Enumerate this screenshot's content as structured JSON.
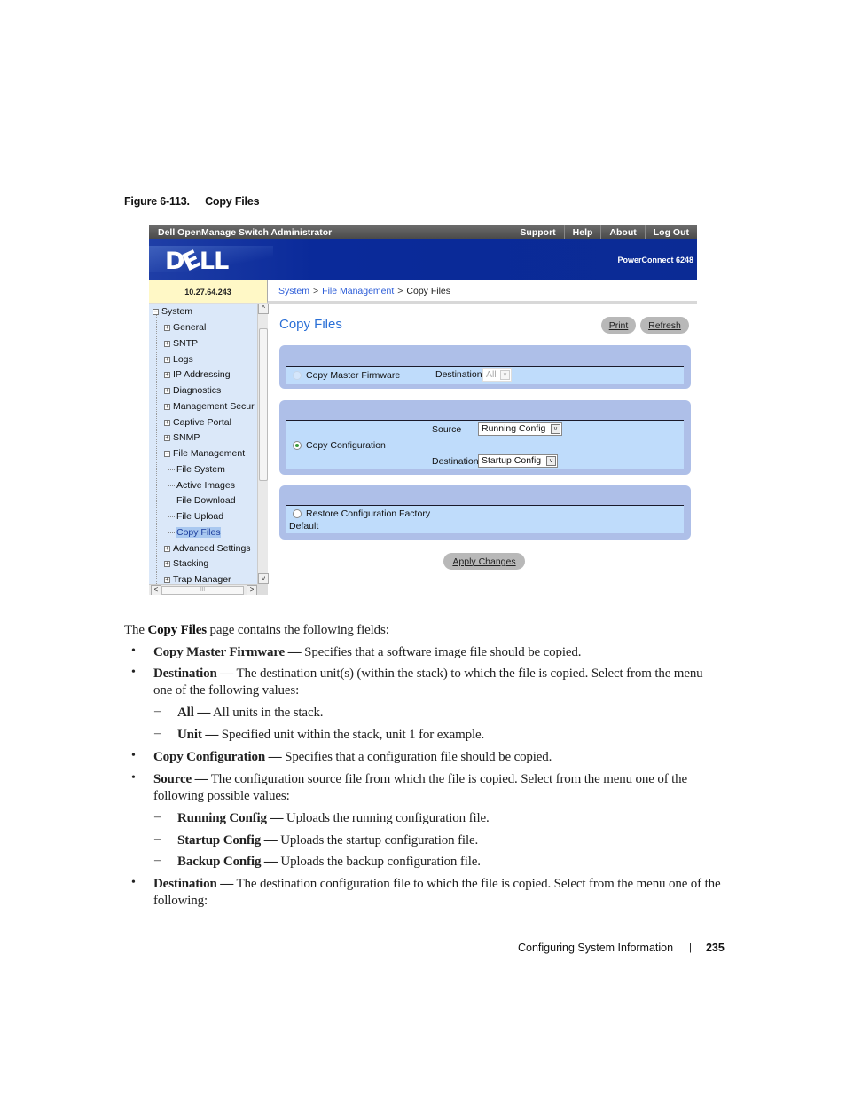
{
  "figure": {
    "number": "Figure 6-113.",
    "title": "Copy Files"
  },
  "app": {
    "title": "Dell OpenManage Switch Administrator",
    "top_links": [
      "Support",
      "Help",
      "About",
      "Log Out"
    ],
    "logo": {
      "d": "D",
      "e": "E",
      "ll": "LL"
    },
    "product": "PowerConnect 6248",
    "ip_address": "10.27.64.243",
    "breadcrumb": {
      "items": [
        "System",
        "File Management",
        "Copy Files"
      ],
      "separator": ">"
    }
  },
  "sidebar": {
    "root": "System",
    "items": [
      {
        "label": "General"
      },
      {
        "label": "SNTP"
      },
      {
        "label": "Logs"
      },
      {
        "label": "IP Addressing"
      },
      {
        "label": "Diagnostics"
      },
      {
        "label": "Management Secur"
      },
      {
        "label": "Captive Portal"
      },
      {
        "label": "SNMP"
      },
      {
        "label": "File Management"
      },
      {
        "label": "File System"
      },
      {
        "label": "Active Images"
      },
      {
        "label": "File Download"
      },
      {
        "label": "File Upload"
      },
      {
        "label": "Copy Files"
      },
      {
        "label": "Advanced Settings"
      },
      {
        "label": "Stacking"
      },
      {
        "label": "Trap Manager"
      }
    ],
    "selected": "Copy Files",
    "scroll_up": "^",
    "scroll_down": "v",
    "scroll_left": "<",
    "scroll_right": ">",
    "grip": "III"
  },
  "main": {
    "title": "Copy Files",
    "print_label": "Print",
    "refresh_label": "Refresh",
    "firmware": {
      "label": "Copy Master Firmware",
      "dest_label": "Destination",
      "dest_value": "All"
    },
    "config": {
      "label": "Copy Configuration",
      "source_label": "Source",
      "source_value": "Running Config",
      "dest_label": "Destination",
      "dest_value": "Startup Config"
    },
    "restore": {
      "label": "Restore Configuration Factory",
      "label2": "Default"
    },
    "apply_label": "Apply Changes",
    "arrow": "v"
  },
  "body": {
    "intro_pre": "The ",
    "intro_bold": "Copy Files",
    "intro_post": " page contains the following fields:",
    "bullet_char": "•",
    "dash_char": "–",
    "items": [
      {
        "term": "Copy Master Firmware —",
        "desc": " Specifies that a software image file should be copied."
      },
      {
        "term": "Destination —",
        "desc": " The destination unit(s) (within the stack) to which the file is copied. Select from the menu one of the following values:"
      },
      {
        "term": "Copy Configuration —",
        "desc": " Specifies that a configuration file should be copied."
      },
      {
        "term": "Source —",
        "desc": " The configuration source file from which the file is copied. Select from the menu one of the following possible values:"
      },
      {
        "term": "Destination —",
        "desc": " The destination configuration file to which the file is copied. Select from the menu one of the following:"
      }
    ],
    "dest_values": [
      {
        "term": "All —",
        "desc": " All units in the stack."
      },
      {
        "term": "Unit —",
        "desc": " Specified unit within the stack, unit 1 for example."
      }
    ],
    "source_values": [
      {
        "term": "Running Config —",
        "desc": " Uploads the running configuration file."
      },
      {
        "term": "Startup Config —",
        "desc": " Uploads the startup configuration file."
      },
      {
        "term": "Backup Config —",
        "desc": " Uploads the backup configuration file."
      }
    ]
  },
  "footer": {
    "section": "Configuring System Information",
    "divider": "|",
    "page": "235"
  }
}
